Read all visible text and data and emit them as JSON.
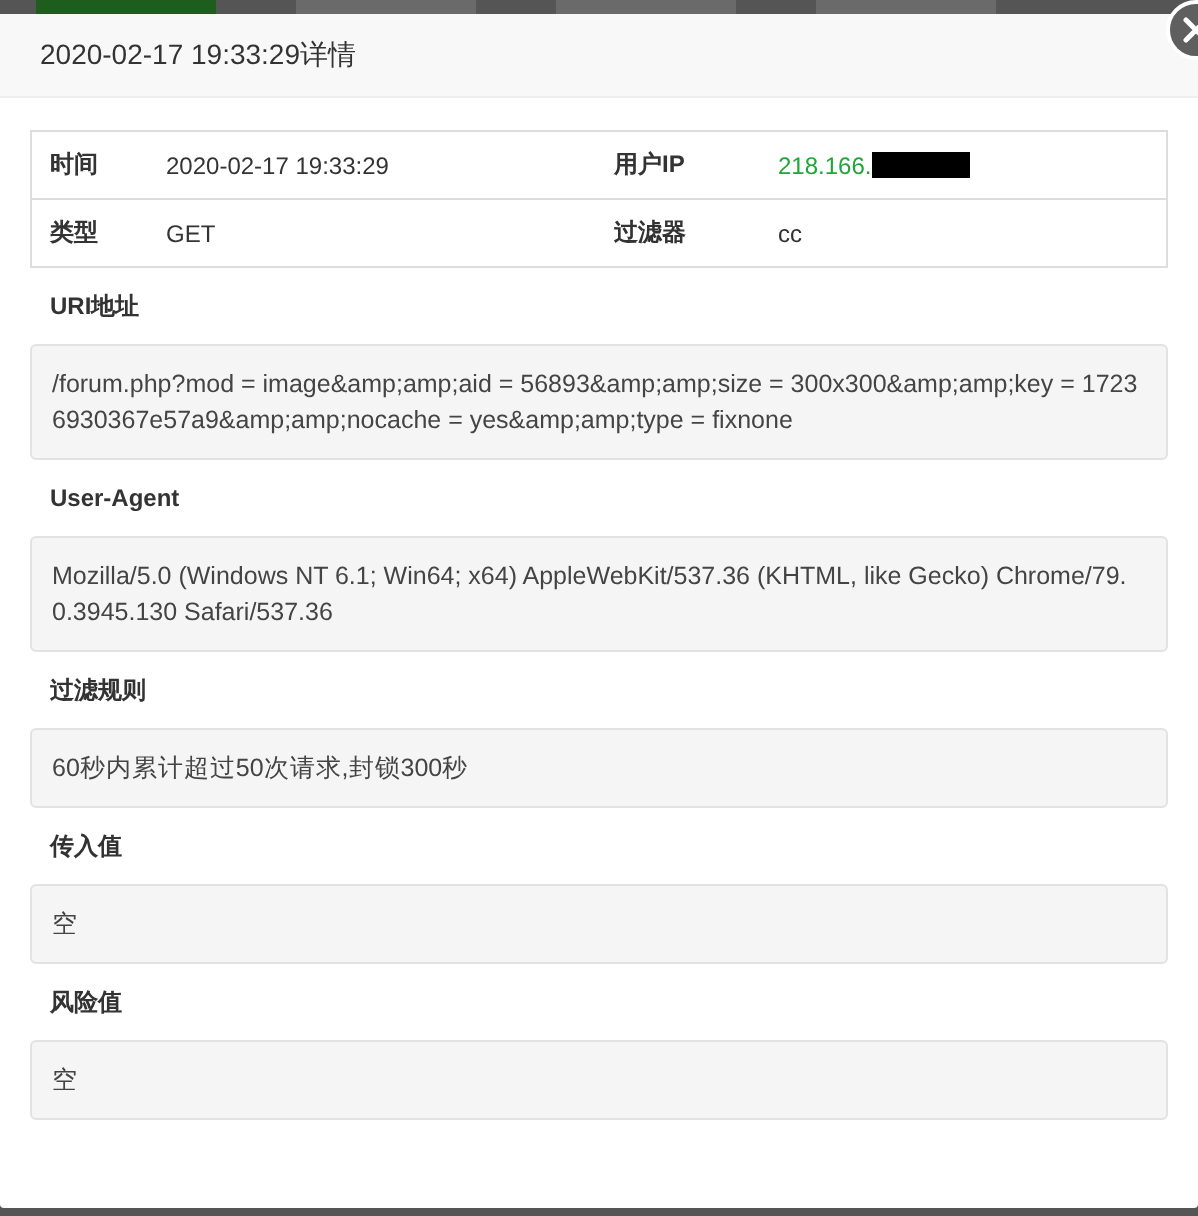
{
  "background_tabs": [
    {
      "selected": true
    },
    {
      "selected": false
    },
    {
      "selected": false
    },
    {
      "selected": false
    }
  ],
  "dialog": {
    "title": "2020-02-17 19:33:29详情"
  },
  "info_table": [
    [
      {
        "label": "时间",
        "value": "2020-02-17 19:33:29",
        "kind": "plain"
      },
      {
        "label": "用户IP",
        "value": "218.166.",
        "kind": "ip"
      }
    ],
    [
      {
        "label": "类型",
        "value": "GET",
        "kind": "plain"
      },
      {
        "label": "过滤器",
        "value": "cc",
        "kind": "plain"
      }
    ]
  ],
  "sections": [
    {
      "label": "URI地址",
      "value": "/forum.php?mod = image&amp;amp;aid = 56893&amp;amp;size = 300x300&amp;amp;key = 17236930367e57a9&amp;amp;nocache = yes&amp;amp;type = fixnone"
    },
    {
      "label": "User-Agent",
      "value": "Mozilla/5.0 (Windows NT 6.1; Win64; x64) AppleWebKit/537.36 (KHTML, like Gecko) Chrome/79.0.3945.130 Safari/537.36"
    },
    {
      "label": "过滤规则",
      "value": "60秒内累计超过50次请求,封锁300秒"
    },
    {
      "label": "传入值",
      "value": "空"
    },
    {
      "label": "风险值",
      "value": "空"
    }
  ]
}
